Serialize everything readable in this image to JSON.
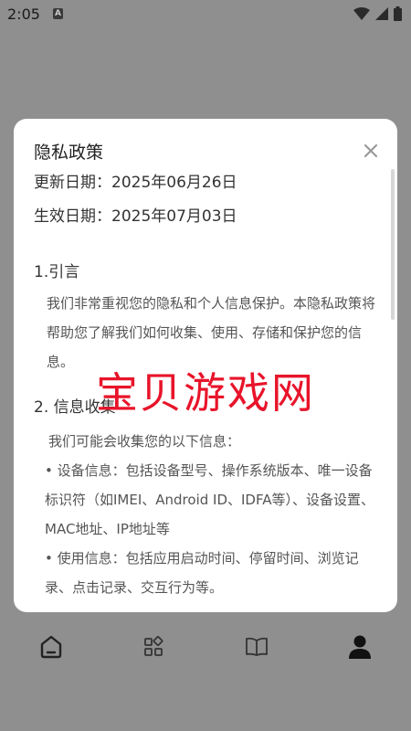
{
  "status_bar": {
    "time": "2:05",
    "notification_badge": "A"
  },
  "dialog": {
    "title": "隐私政策",
    "updated": "更新日期：2025年06月26日",
    "effective": "生效日期：2025年07月03日",
    "section1_title": "1.引言",
    "section1_body": "我们非常重视您的隐私和个人信息保护。本隐私政策将帮助您了解我们如何收集、使用、存储和保护您的信息。",
    "section2_title": "2. 信息收集",
    "section2_intro": "我们可能会收集您的以下信息：",
    "section2_body": "• 设备信息：包括设备型号、操作系统版本、唯一设备标识符（如IMEI、Android ID、IDFA等）、设备设置、MAC地址、IP地址等\n• 使用信息：包括应用启动时间、停留时间、浏览记录、点击记录、交互行为等。"
  },
  "watermark": "宝贝游戏网",
  "bottom_nav": {
    "items": [
      "home-icon",
      "apps-icon",
      "book-icon",
      "profile-icon"
    ],
    "active_index": 3
  },
  "colors": {
    "backdrop": "#8f8f8f",
    "dialog_bg": "#ffffff",
    "watermark": "#e8142a"
  }
}
